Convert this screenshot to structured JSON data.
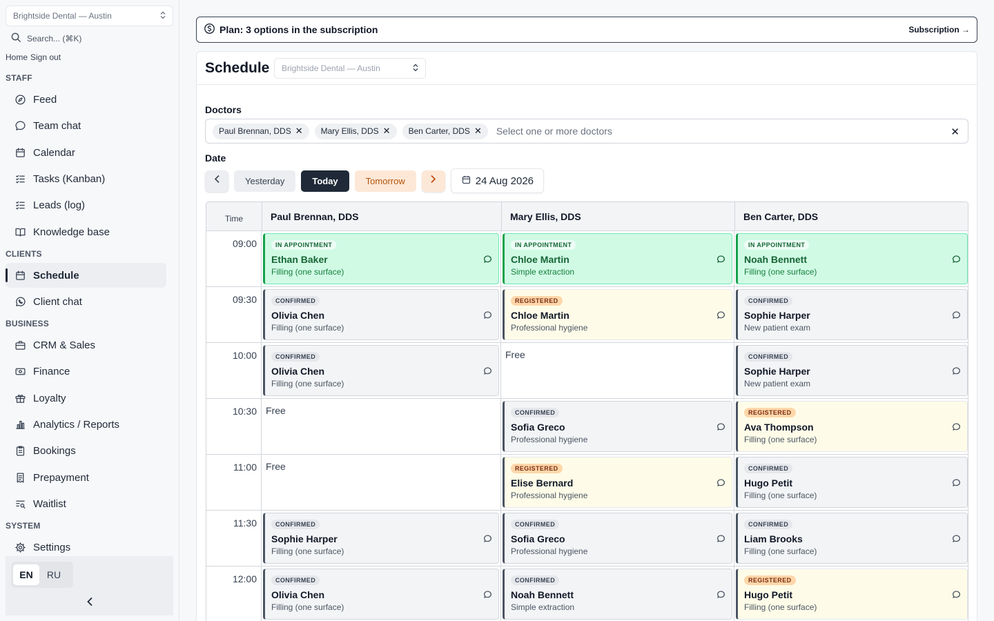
{
  "sidebar": {
    "org_select": "Brightside Dental — Austin",
    "search_placeholder": "Search... (⌘K)",
    "home_link": "Home",
    "signout_link": "Sign out",
    "sections": {
      "staff": "STAFF",
      "clients": "CLIENTS",
      "business": "BUSINESS",
      "system": "SYSTEM"
    },
    "items": {
      "feed": "Feed",
      "team_chat": "Team chat",
      "calendar": "Calendar",
      "tasks": "Tasks (Kanban)",
      "leads": "Leads (log)",
      "knowledge": "Knowledge base",
      "schedule": "Schedule",
      "client_chat": "Client chat",
      "crm": "CRM & Sales",
      "finance": "Finance",
      "loyalty": "Loyalty",
      "analytics": "Analytics / Reports",
      "bookings": "Bookings",
      "prepayment": "Prepayment",
      "waitlist": "Waitlist",
      "settings": "Settings"
    },
    "languages": [
      "EN",
      "RU"
    ],
    "active_language": "EN"
  },
  "plan_bar": {
    "text": "Plan: 3 options in the subscription",
    "link": "Subscription →"
  },
  "schedule": {
    "title": "Schedule",
    "location_select": "Brightside Dental — Austin",
    "doctors_label": "Doctors",
    "doctor_chips": [
      "Paul Brennan, DDS",
      "Mary Ellis, DDS",
      "Ben Carter, DDS"
    ],
    "doctors_placeholder": "Select one or more doctors",
    "date_label": "Date",
    "yesterday": "Yesterday",
    "today": "Today",
    "tomorrow": "Tomorrow",
    "current_date": "24 Aug 2026",
    "time_header": "Time",
    "columns": [
      "Paul Brennan, DDS",
      "Mary Ellis, DDS",
      "Ben Carter, DDS"
    ],
    "rows": [
      {
        "time": "09:00",
        "slots": [
          {
            "status": "IN APPOINTMENT",
            "kind": "inappt",
            "patient": "Ethan Baker",
            "service": "Filling (one surface)"
          },
          {
            "status": "IN APPOINTMENT",
            "kind": "inappt",
            "patient": "Chloe Martin",
            "service": "Simple extraction"
          },
          {
            "status": "IN APPOINTMENT",
            "kind": "inappt",
            "patient": "Noah Bennett",
            "service": "Filling (one surface)"
          }
        ]
      },
      {
        "time": "09:30",
        "slots": [
          {
            "status": "CONFIRMED",
            "kind": "confirmed",
            "patient": "Olivia Chen",
            "service": "Filling (one surface)"
          },
          {
            "status": "REGISTERED",
            "kind": "registered",
            "patient": "Chloe Martin",
            "service": "Professional hygiene"
          },
          {
            "status": "CONFIRMED",
            "kind": "confirmed",
            "patient": "Sophie Harper",
            "service": "New patient exam"
          }
        ]
      },
      {
        "time": "10:00",
        "slots": [
          {
            "status": "CONFIRMED",
            "kind": "confirmed",
            "patient": "Olivia Chen",
            "service": "Filling (one surface)"
          },
          {
            "free": "Free"
          },
          {
            "status": "CONFIRMED",
            "kind": "confirmed",
            "patient": "Sophie Harper",
            "service": "New patient exam"
          }
        ]
      },
      {
        "time": "10:30",
        "slots": [
          {
            "free": "Free"
          },
          {
            "status": "CONFIRMED",
            "kind": "confirmed",
            "patient": "Sofia Greco",
            "service": "Professional hygiene"
          },
          {
            "status": "REGISTERED",
            "kind": "registered",
            "patient": "Ava Thompson",
            "service": "Filling (one surface)"
          }
        ]
      },
      {
        "time": "11:00",
        "slots": [
          {
            "free": "Free"
          },
          {
            "status": "REGISTERED",
            "kind": "registered",
            "patient": "Elise Bernard",
            "service": "Professional hygiene"
          },
          {
            "status": "CONFIRMED",
            "kind": "confirmed",
            "patient": "Hugo Petit",
            "service": "Filling (one surface)"
          }
        ]
      },
      {
        "time": "11:30",
        "slots": [
          {
            "status": "CONFIRMED",
            "kind": "confirmed",
            "patient": "Sophie Harper",
            "service": "Filling (one surface)"
          },
          {
            "status": "CONFIRMED",
            "kind": "confirmed",
            "patient": "Sofia Greco",
            "service": "Professional hygiene"
          },
          {
            "status": "CONFIRMED",
            "kind": "confirmed",
            "patient": "Liam Brooks",
            "service": "Filling (one surface)"
          }
        ]
      },
      {
        "time": "12:00",
        "slots": [
          {
            "status": "CONFIRMED",
            "kind": "confirmed",
            "patient": "Olivia Chen",
            "service": "Filling (one surface)"
          },
          {
            "status": "CONFIRMED",
            "kind": "confirmed",
            "patient": "Noah Bennett",
            "service": "Simple extraction"
          },
          {
            "status": "REGISTERED",
            "kind": "registered",
            "patient": "Hugo Petit",
            "service": "Filling (one surface)"
          }
        ]
      }
    ]
  },
  "colors": {
    "in_appointment_bg": "#d1fae5",
    "in_appointment_border": "#16a34a",
    "confirmed_bg": "#f3f4f6",
    "registered_bg": "#fefce8",
    "registered_badge": "#fed7aa",
    "today_button": "#1f2937",
    "tomorrow_button": "#fde8d7"
  }
}
